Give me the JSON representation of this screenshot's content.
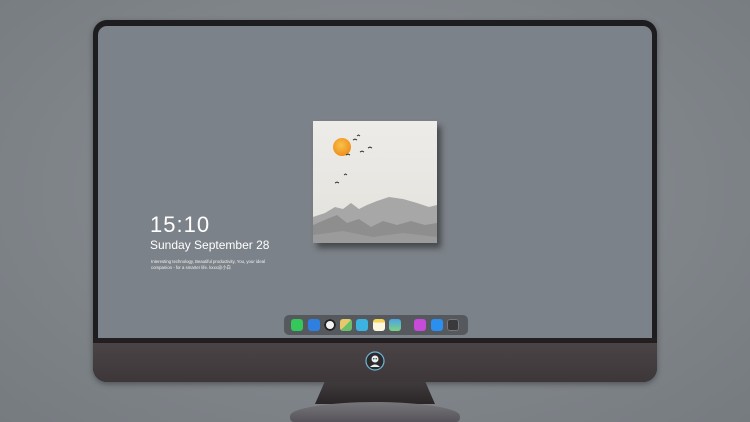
{
  "clock": {
    "time": "15:10",
    "date": "Sunday September 28",
    "caption": "Interesting technology, Beautiful productivity, You, your ideal companion - for a smarter life. kxxx@小白"
  },
  "widget": {
    "subject": "ink-painting landscape: orange sun, flying birds, grey mountains"
  },
  "dock": {
    "items": [
      {
        "name": "messages-icon",
        "color": "#34c759"
      },
      {
        "name": "files-icon",
        "color": "#2f7fe0"
      },
      {
        "name": "clock-icon",
        "color": "#f2f2f2"
      },
      {
        "name": "maps-icon",
        "color": "#e7c86a"
      },
      {
        "name": "clapper-icon",
        "color": "#3bb2e0"
      },
      {
        "name": "notes-icon",
        "color": "#f6d35a"
      },
      {
        "name": "photos-icon",
        "color": "#4aa4e6"
      },
      {
        "name": "music-icon",
        "color": "#c54bd8"
      },
      {
        "name": "app-store-icon",
        "color": "#2b8ff0"
      },
      {
        "name": "camera-icon",
        "color": "#3a3a3c"
      }
    ]
  },
  "colors": {
    "screen": "#7c8289",
    "dock": "#55595e",
    "sun": "#f5a623"
  }
}
